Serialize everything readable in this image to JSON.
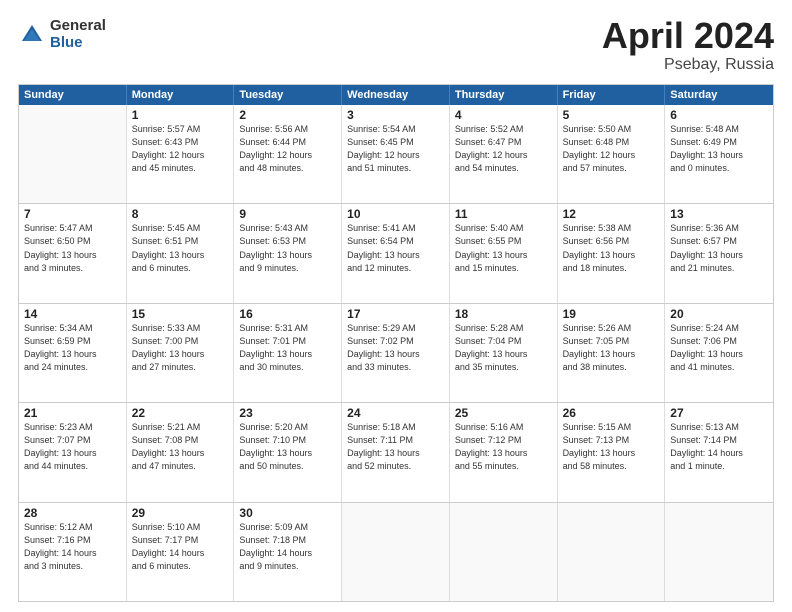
{
  "logo": {
    "general": "General",
    "blue": "Blue"
  },
  "title": {
    "month": "April 2024",
    "location": "Psebay, Russia"
  },
  "header": {
    "days": [
      "Sunday",
      "Monday",
      "Tuesday",
      "Wednesday",
      "Thursday",
      "Friday",
      "Saturday"
    ]
  },
  "weeks": [
    [
      {
        "day": "",
        "info": ""
      },
      {
        "day": "1",
        "info": "Sunrise: 5:57 AM\nSunset: 6:43 PM\nDaylight: 12 hours\nand 45 minutes."
      },
      {
        "day": "2",
        "info": "Sunrise: 5:56 AM\nSunset: 6:44 PM\nDaylight: 12 hours\nand 48 minutes."
      },
      {
        "day": "3",
        "info": "Sunrise: 5:54 AM\nSunset: 6:45 PM\nDaylight: 12 hours\nand 51 minutes."
      },
      {
        "day": "4",
        "info": "Sunrise: 5:52 AM\nSunset: 6:47 PM\nDaylight: 12 hours\nand 54 minutes."
      },
      {
        "day": "5",
        "info": "Sunrise: 5:50 AM\nSunset: 6:48 PM\nDaylight: 12 hours\nand 57 minutes."
      },
      {
        "day": "6",
        "info": "Sunrise: 5:48 AM\nSunset: 6:49 PM\nDaylight: 13 hours\nand 0 minutes."
      }
    ],
    [
      {
        "day": "7",
        "info": "Sunrise: 5:47 AM\nSunset: 6:50 PM\nDaylight: 13 hours\nand 3 minutes."
      },
      {
        "day": "8",
        "info": "Sunrise: 5:45 AM\nSunset: 6:51 PM\nDaylight: 13 hours\nand 6 minutes."
      },
      {
        "day": "9",
        "info": "Sunrise: 5:43 AM\nSunset: 6:53 PM\nDaylight: 13 hours\nand 9 minutes."
      },
      {
        "day": "10",
        "info": "Sunrise: 5:41 AM\nSunset: 6:54 PM\nDaylight: 13 hours\nand 12 minutes."
      },
      {
        "day": "11",
        "info": "Sunrise: 5:40 AM\nSunset: 6:55 PM\nDaylight: 13 hours\nand 15 minutes."
      },
      {
        "day": "12",
        "info": "Sunrise: 5:38 AM\nSunset: 6:56 PM\nDaylight: 13 hours\nand 18 minutes."
      },
      {
        "day": "13",
        "info": "Sunrise: 5:36 AM\nSunset: 6:57 PM\nDaylight: 13 hours\nand 21 minutes."
      }
    ],
    [
      {
        "day": "14",
        "info": "Sunrise: 5:34 AM\nSunset: 6:59 PM\nDaylight: 13 hours\nand 24 minutes."
      },
      {
        "day": "15",
        "info": "Sunrise: 5:33 AM\nSunset: 7:00 PM\nDaylight: 13 hours\nand 27 minutes."
      },
      {
        "day": "16",
        "info": "Sunrise: 5:31 AM\nSunset: 7:01 PM\nDaylight: 13 hours\nand 30 minutes."
      },
      {
        "day": "17",
        "info": "Sunrise: 5:29 AM\nSunset: 7:02 PM\nDaylight: 13 hours\nand 33 minutes."
      },
      {
        "day": "18",
        "info": "Sunrise: 5:28 AM\nSunset: 7:04 PM\nDaylight: 13 hours\nand 35 minutes."
      },
      {
        "day": "19",
        "info": "Sunrise: 5:26 AM\nSunset: 7:05 PM\nDaylight: 13 hours\nand 38 minutes."
      },
      {
        "day": "20",
        "info": "Sunrise: 5:24 AM\nSunset: 7:06 PM\nDaylight: 13 hours\nand 41 minutes."
      }
    ],
    [
      {
        "day": "21",
        "info": "Sunrise: 5:23 AM\nSunset: 7:07 PM\nDaylight: 13 hours\nand 44 minutes."
      },
      {
        "day": "22",
        "info": "Sunrise: 5:21 AM\nSunset: 7:08 PM\nDaylight: 13 hours\nand 47 minutes."
      },
      {
        "day": "23",
        "info": "Sunrise: 5:20 AM\nSunset: 7:10 PM\nDaylight: 13 hours\nand 50 minutes."
      },
      {
        "day": "24",
        "info": "Sunrise: 5:18 AM\nSunset: 7:11 PM\nDaylight: 13 hours\nand 52 minutes."
      },
      {
        "day": "25",
        "info": "Sunrise: 5:16 AM\nSunset: 7:12 PM\nDaylight: 13 hours\nand 55 minutes."
      },
      {
        "day": "26",
        "info": "Sunrise: 5:15 AM\nSunset: 7:13 PM\nDaylight: 13 hours\nand 58 minutes."
      },
      {
        "day": "27",
        "info": "Sunrise: 5:13 AM\nSunset: 7:14 PM\nDaylight: 14 hours\nand 1 minute."
      }
    ],
    [
      {
        "day": "28",
        "info": "Sunrise: 5:12 AM\nSunset: 7:16 PM\nDaylight: 14 hours\nand 3 minutes."
      },
      {
        "day": "29",
        "info": "Sunrise: 5:10 AM\nSunset: 7:17 PM\nDaylight: 14 hours\nand 6 minutes."
      },
      {
        "day": "30",
        "info": "Sunrise: 5:09 AM\nSunset: 7:18 PM\nDaylight: 14 hours\nand 9 minutes."
      },
      {
        "day": "",
        "info": ""
      },
      {
        "day": "",
        "info": ""
      },
      {
        "day": "",
        "info": ""
      },
      {
        "day": "",
        "info": ""
      }
    ]
  ]
}
